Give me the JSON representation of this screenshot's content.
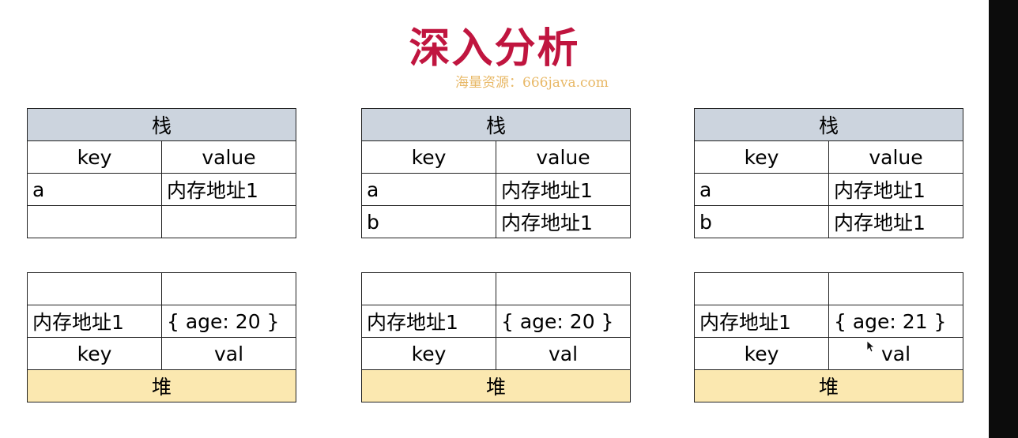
{
  "title": "深入分析",
  "watermark": "海量资源：666java.com",
  "panels": [
    {
      "stack": {
        "title": "栈",
        "key_header": "key",
        "value_header": "value",
        "rows": [
          {
            "key": "a",
            "value": "内存地址1"
          },
          {
            "key": "",
            "value": ""
          }
        ]
      },
      "heap": {
        "rows": [
          {
            "address": "",
            "value": ""
          },
          {
            "address": "内存地址1",
            "value": "{ age: 20 }"
          }
        ],
        "key_header": "key",
        "val_header": "val",
        "title": "堆"
      }
    },
    {
      "stack": {
        "title": "栈",
        "key_header": "key",
        "value_header": "value",
        "rows": [
          {
            "key": "a",
            "value": "内存地址1"
          },
          {
            "key": "b",
            "value": "内存地址1"
          }
        ]
      },
      "heap": {
        "rows": [
          {
            "address": "",
            "value": ""
          },
          {
            "address": "内存地址1",
            "value": "{ age: 20 }"
          }
        ],
        "key_header": "key",
        "val_header": "val",
        "title": "堆"
      }
    },
    {
      "stack": {
        "title": "栈",
        "key_header": "key",
        "value_header": "value",
        "rows": [
          {
            "key": "a",
            "value": "内存地址1"
          },
          {
            "key": "b",
            "value": "内存地址1"
          }
        ]
      },
      "heap": {
        "rows": [
          {
            "address": "",
            "value": ""
          },
          {
            "address": "内存地址1",
            "value": "{ age: 21 }"
          }
        ],
        "key_header": "key",
        "val_header": "val",
        "title": "堆"
      }
    }
  ],
  "icons": {
    "cursor": "mouse-pointer-icon"
  }
}
